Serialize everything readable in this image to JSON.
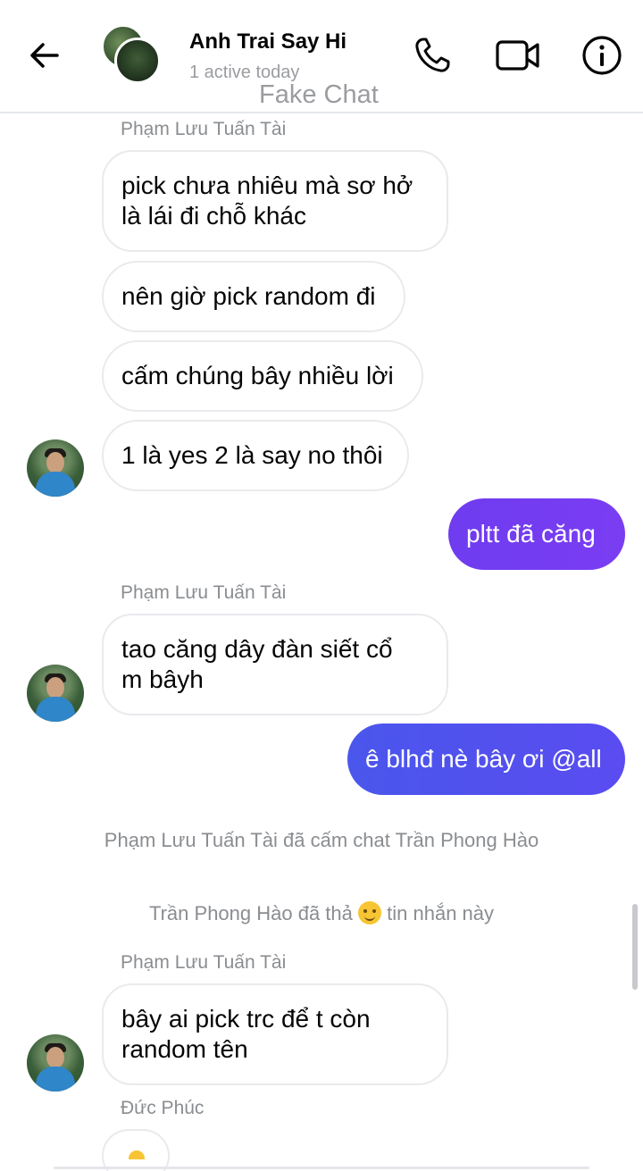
{
  "header": {
    "title": "Anh Trai Say Hi",
    "status": "1 active today",
    "watermark": "Fake Chat",
    "icons": [
      "back-arrow-icon",
      "phone-icon",
      "video-camera-icon",
      "info-icon"
    ]
  },
  "messages": [
    {
      "sender": "Phạm Lưu Tuấn Tài"
    },
    {
      "text": "pick chưa nhiêu mà sơ hở\nlà lái đi chỗ khác"
    },
    {
      "text": "nên giờ pick random đi"
    },
    {
      "text": "cấm chúng bây nhiều lời"
    },
    {
      "text": "1 là yes 2 là say no thôi"
    },
    {
      "text": "pltt đã căng"
    },
    {
      "sender": "Phạm Lưu Tuấn Tài"
    },
    {
      "text": "tao căng dây đàn siết cổ\nm bâyh"
    },
    {
      "text": "ê blhđ nè bây ơi @all"
    },
    {
      "system": "Phạm Lưu Tuấn Tài đã cấm chat Trần Phong Hào"
    },
    {
      "system_pre": "Trần Phong Hào đã thả",
      "system_post": "tin nhắn này",
      "emoji": "smiling-face-icon"
    },
    {
      "sender": "Phạm Lưu Tuấn Tài"
    },
    {
      "text": "bây ai pick trc để t còn\nrandom tên"
    },
    {
      "sender": "Đức Phúc"
    }
  ],
  "colors": {
    "outgoing_1": "#7340F0",
    "outgoing_2": "#4F52EE",
    "incoming_border": "#E9EAED",
    "secondary_text": "#8A8D91"
  }
}
